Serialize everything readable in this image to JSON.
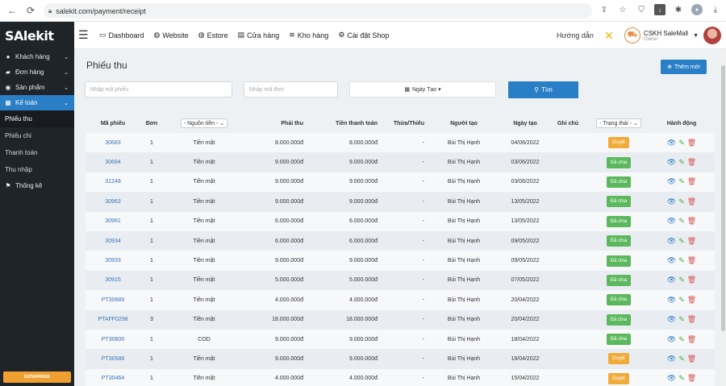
{
  "browser": {
    "url": "salekit.com/payment/receipt"
  },
  "sidebar": {
    "logo": "SAlekit",
    "items": [
      {
        "label": "Khách hàng",
        "icon": "user-icon"
      },
      {
        "label": "Đơn hàng",
        "icon": "truck-icon"
      },
      {
        "label": "Sản phẩm",
        "icon": "product-icon"
      },
      {
        "label": "Kế toán",
        "icon": "calculator-icon"
      }
    ],
    "subitems": [
      "Phiếu thu",
      "Phiếu chi",
      "Thanh toán",
      "Thu nhập"
    ],
    "bottom_item": {
      "label": "Thống kê",
      "icon": "flag-icon"
    },
    "enterprise": "ENTERPRISE"
  },
  "topnav": {
    "items": [
      {
        "label": "Dashboard",
        "icon": "monitor-icon"
      },
      {
        "label": "Website",
        "icon": "globe-icon"
      },
      {
        "label": "Estore",
        "icon": "globe-icon"
      },
      {
        "label": "Cửa hàng",
        "icon": "store-icon"
      },
      {
        "label": "Kho hàng",
        "icon": "stack-icon"
      },
      {
        "label": "Cài đặt Shop",
        "icon": "gear-icon"
      }
    ],
    "help": "Hướng dẫn",
    "user_name": "CSKH SaleMall",
    "user_role": "Owner"
  },
  "page": {
    "title": "Phiếu thu",
    "add_button": "Thêm mới",
    "receipt_placeholder": "Nhập mã phiếu",
    "order_placeholder": "Nhập mã đơn",
    "date_button": "Ngày Tạo",
    "search_button": "Tìm"
  },
  "table": {
    "headers": {
      "code": "Mã phiếu",
      "order": "Đơn",
      "source": "- Nguồn tiền -",
      "payable": "Phải thu",
      "paid": "Tiền thanh toán",
      "diff": "Thừa/Thiếu",
      "creator": "Người tạo",
      "date": "Ngày tạo",
      "note": "Ghi chú",
      "status": "- Trạng thái -",
      "action": "Hành động"
    },
    "rows": [
      {
        "code": "30683",
        "order": "1",
        "source": "Tiền mặt",
        "payable": "8.000.000đ",
        "paid": "8.000.000đ",
        "diff": "-",
        "creator": "Bùi Thị Hạnh",
        "date": "04/06/2022",
        "note": "",
        "status": "Duyệt",
        "status_type": "duyet"
      },
      {
        "code": "30684",
        "order": "1",
        "source": "Tiền mặt",
        "payable": "9.000.000đ",
        "paid": "9.000.000đ",
        "diff": "-",
        "creator": "Bùi Thị Hạnh",
        "date": "03/06/2022",
        "note": "",
        "status": "Đã chia",
        "status_type": "dachia"
      },
      {
        "code": "31248",
        "order": "1",
        "source": "Tiền mặt",
        "payable": "9.000.000đ",
        "paid": "9.000.000đ",
        "diff": "-",
        "creator": "Bùi Thị Hạnh",
        "date": "03/06/2022",
        "note": "",
        "status": "Đã chia",
        "status_type": "dachia"
      },
      {
        "code": "30963",
        "order": "1",
        "source": "Tiền mặt",
        "payable": "9.000.000đ",
        "paid": "9.000.000đ",
        "diff": "-",
        "creator": "Bùi Thị Hạnh",
        "date": "13/05/2022",
        "note": "",
        "status": "Đã chia",
        "status_type": "dachia"
      },
      {
        "code": "30961",
        "order": "1",
        "source": "Tiền mặt",
        "payable": "6.000.000đ",
        "paid": "6.000.000đ",
        "diff": "-",
        "creator": "Bùi Thị Hạnh",
        "date": "13/05/2022",
        "note": "",
        "status": "Đã chia",
        "status_type": "dachia"
      },
      {
        "code": "30934",
        "order": "1",
        "source": "Tiền mặt",
        "payable": "6.000.000đ",
        "paid": "6.000.000đ",
        "diff": "-",
        "creator": "Bùi Thị Hạnh",
        "date": "09/05/2022",
        "note": "",
        "status": "Đã chia",
        "status_type": "dachia"
      },
      {
        "code": "30933",
        "order": "1",
        "source": "Tiền mặt",
        "payable": "9.000.000đ",
        "paid": "9.000.000đ",
        "diff": "-",
        "creator": "Bùi Thị Hạnh",
        "date": "09/05/2022",
        "note": "",
        "status": "Đã chia",
        "status_type": "dachia"
      },
      {
        "code": "30915",
        "order": "1",
        "source": "Tiền mặt",
        "payable": "5.000.000đ",
        "paid": "5.000.000đ",
        "diff": "-",
        "creator": "Bùi Thị Hạnh",
        "date": "07/05/2022",
        "note": "",
        "status": "Đã chia",
        "status_type": "dachia"
      },
      {
        "code": "PT30689",
        "order": "1",
        "source": "Tiền mặt",
        "payable": "4.000.000đ",
        "paid": "4.000.000đ",
        "diff": "-",
        "creator": "Bùi Thị Hạnh",
        "date": "20/04/2022",
        "note": "",
        "status": "Đã chia",
        "status_type": "dachia"
      },
      {
        "code": "PTAFF0298",
        "order": "3",
        "source": "Tiền mặt",
        "payable": "18.000.000đ",
        "paid": "18.000.000đ",
        "diff": "-",
        "creator": "Bùi Thị Hạnh",
        "date": "20/04/2022",
        "note": "",
        "status": "Đã chia",
        "status_type": "dachia"
      },
      {
        "code": "PT30606",
        "order": "1",
        "source": "COD",
        "payable": "9.000.000đ",
        "paid": "9.000.000đ",
        "diff": "-",
        "creator": "Bùi Thị Hạnh",
        "date": "18/04/2022",
        "note": "",
        "status": "Đã chia",
        "status_type": "dachia"
      },
      {
        "code": "PT30586",
        "order": "1",
        "source": "Tiền mặt",
        "payable": "9.000.000đ",
        "paid": "9.000.000đ",
        "diff": "-",
        "creator": "Bùi Thị Hạnh",
        "date": "18/04/2022",
        "note": "",
        "status": "Duyệt",
        "status_type": "duyet"
      },
      {
        "code": "PT30464",
        "order": "1",
        "source": "Tiền mặt",
        "payable": "4.000.000đ",
        "paid": "4.000.000đ",
        "diff": "-",
        "creator": "Bùi Thị Hạnh",
        "date": "15/04/2022",
        "note": "",
        "status": "Duyệt",
        "status_type": "duyet"
      }
    ]
  },
  "colors": {
    "accent": "#2a7ec5",
    "sidebar_bg": "#1f2429",
    "badge_duyet": "#f0ab3a",
    "badge_dachia": "#5cb85c"
  }
}
